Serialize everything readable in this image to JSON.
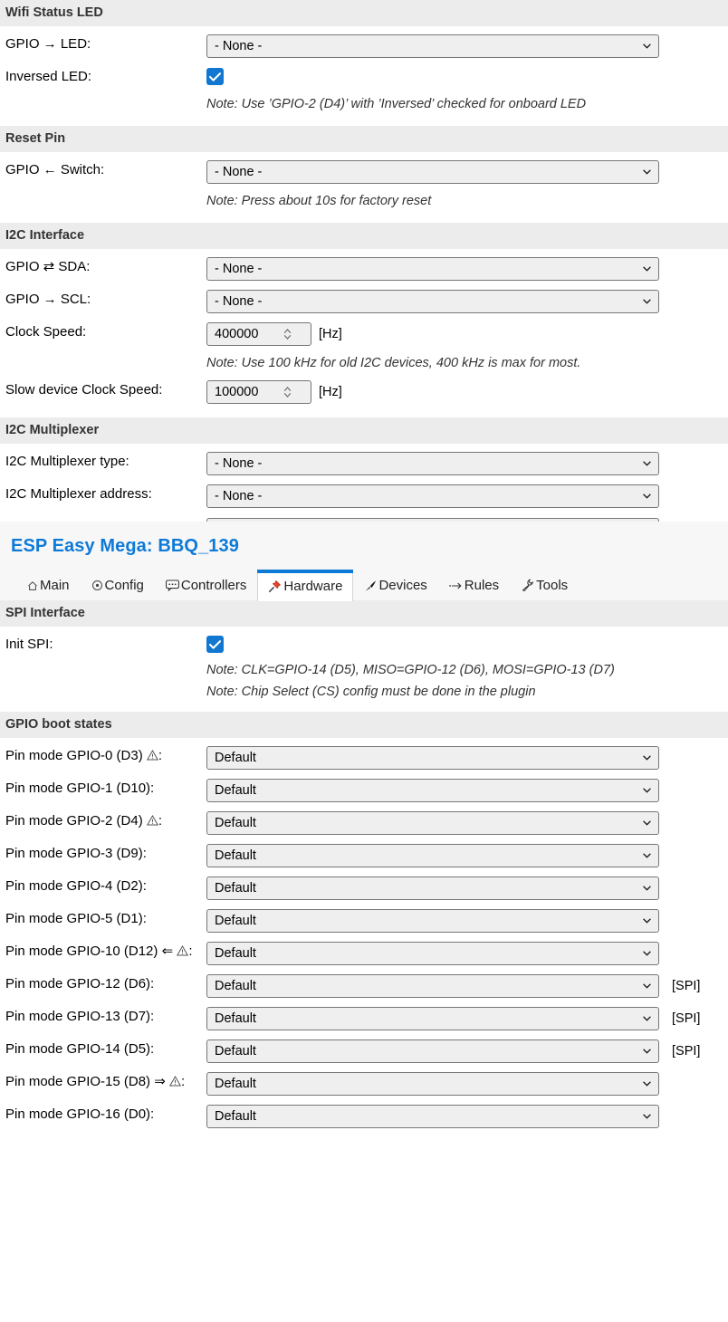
{
  "app": {
    "title": "ESP Easy Mega: BBQ_139",
    "accent_color": "#0d7ad8",
    "section_header_bg": "#ececec",
    "checkbox_color": "#1177d1"
  },
  "tabs": [
    {
      "label": "Main",
      "icon": "home-icon",
      "glyph": "⌂",
      "active": false
    },
    {
      "label": "Config",
      "icon": "gear-icon",
      "glyph": "⊙",
      "active": false
    },
    {
      "label": "Controllers",
      "icon": "speech-bubble-icon",
      "glyph": "💬",
      "active": false
    },
    {
      "label": "Hardware",
      "icon": "pushpin-icon",
      "glyph": "📌",
      "active": true
    },
    {
      "label": "Devices",
      "icon": "pen-icon",
      "glyph": "✒",
      "active": false
    },
    {
      "label": "Rules",
      "icon": "arrow-right-icon",
      "glyph": "⇾",
      "active": false
    },
    {
      "label": "Tools",
      "icon": "wrench-icon",
      "glyph": "🔧",
      "active": false
    }
  ],
  "sections": {
    "wifi_status_led": {
      "header": "Wifi Status LED",
      "gpio_led_label": "GPIO → LED:",
      "gpio_led_value": "- None -",
      "inversed_label": "Inversed LED:",
      "inversed_checked": true,
      "note": "Note: Use ’GPIO-2 (D4)’ with ’Inversed’ checked for onboard LED"
    },
    "reset_pin": {
      "header": "Reset Pin",
      "gpio_switch_label": "GPIO ← Switch:",
      "gpio_switch_value": "- None -",
      "note": "Note: Press about 10s for factory reset"
    },
    "i2c_interface": {
      "header": "I2C Interface",
      "sda_label": "GPIO ⇄ SDA:",
      "sda_value": "- None -",
      "scl_label": "GPIO → SCL:",
      "scl_value": "- None -",
      "clock_label": "Clock Speed:",
      "clock_value": "400000",
      "clock_unit": "[Hz]",
      "note": "Note: Use 100 kHz for old I2C devices, 400 kHz is max for most.",
      "slow_label": "Slow device Clock Speed:",
      "slow_value": "100000",
      "slow_unit": "[Hz]"
    },
    "i2c_multiplexer": {
      "header": "I2C Multiplexer",
      "type_label": "I2C Multiplexer type:",
      "type_value": "- None -",
      "address_label": "I2C Multiplexer address:",
      "address_value": "- None -"
    },
    "spi_interface": {
      "header": "SPI Interface",
      "init_label": "Init SPI:",
      "init_checked": true,
      "note1": "Note: CLK=GPIO-14 (D5), MISO=GPIO-12 (D6), MOSI=GPIO-13 (D7)",
      "note2": "Note: Chip Select (CS) config must be done in the plugin"
    },
    "gpio_boot_states": {
      "header": "GPIO boot states",
      "rows": [
        {
          "label": "Pin mode GPIO-0 (D3)",
          "warn": true,
          "arrow": "",
          "value": "Default",
          "suffix": ""
        },
        {
          "label": "Pin mode GPIO-1 (D10)",
          "warn": false,
          "arrow": "",
          "value": "Default",
          "suffix": ""
        },
        {
          "label": "Pin mode GPIO-2 (D4)",
          "warn": true,
          "arrow": "",
          "value": "Default",
          "suffix": ""
        },
        {
          "label": "Pin mode GPIO-3 (D9)",
          "warn": false,
          "arrow": "",
          "value": "Default",
          "suffix": ""
        },
        {
          "label": "Pin mode GPIO-4 (D2)",
          "warn": false,
          "arrow": "",
          "value": "Default",
          "suffix": ""
        },
        {
          "label": "Pin mode GPIO-5 (D1)",
          "warn": false,
          "arrow": "",
          "value": "Default",
          "suffix": ""
        },
        {
          "label": "Pin mode GPIO-10 (D12)",
          "warn": true,
          "arrow": "⇐",
          "value": "Default",
          "suffix": ""
        },
        {
          "label": "Pin mode GPIO-12 (D6)",
          "warn": false,
          "arrow": "",
          "value": "Default",
          "suffix": "[SPI]"
        },
        {
          "label": "Pin mode GPIO-13 (D7)",
          "warn": false,
          "arrow": "",
          "value": "Default",
          "suffix": "[SPI]"
        },
        {
          "label": "Pin mode GPIO-14 (D5)",
          "warn": false,
          "arrow": "",
          "value": "Default",
          "suffix": "[SPI]"
        },
        {
          "label": "Pin mode GPIO-15 (D8)",
          "warn": true,
          "arrow": "⇒",
          "value": "Default",
          "suffix": ""
        },
        {
          "label": "Pin mode GPIO-16 (D0)",
          "warn": false,
          "arrow": "",
          "value": "Default",
          "suffix": ""
        }
      ]
    }
  }
}
